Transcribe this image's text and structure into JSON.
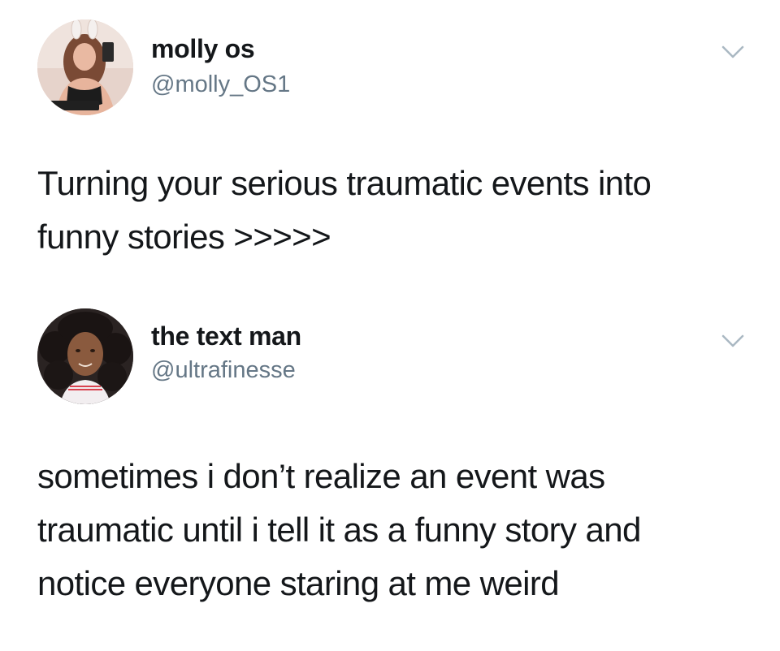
{
  "tweets": [
    {
      "author": {
        "display_name": "molly os",
        "handle": "@molly_OS1",
        "avatar_icon": "user-photo-avatar"
      },
      "menu_icon": "chevron-down-icon",
      "text_lines": [
        "Turning your serious traumatic events into",
        "funny stories >>>>>"
      ]
    },
    {
      "author": {
        "display_name": "the text man",
        "handle": "@ultrafinesse",
        "avatar_icon": "user-photo-avatar"
      },
      "menu_icon": "chevron-down-icon",
      "text_lines": [
        "sometimes i don’t realize an event was",
        "traumatic until i tell it as a funny story and",
        "notice everyone staring at me weird"
      ]
    }
  ],
  "colors": {
    "text_primary": "#14171a",
    "text_secondary": "#657786",
    "chevron": "#aab8c2",
    "background": "#ffffff"
  }
}
